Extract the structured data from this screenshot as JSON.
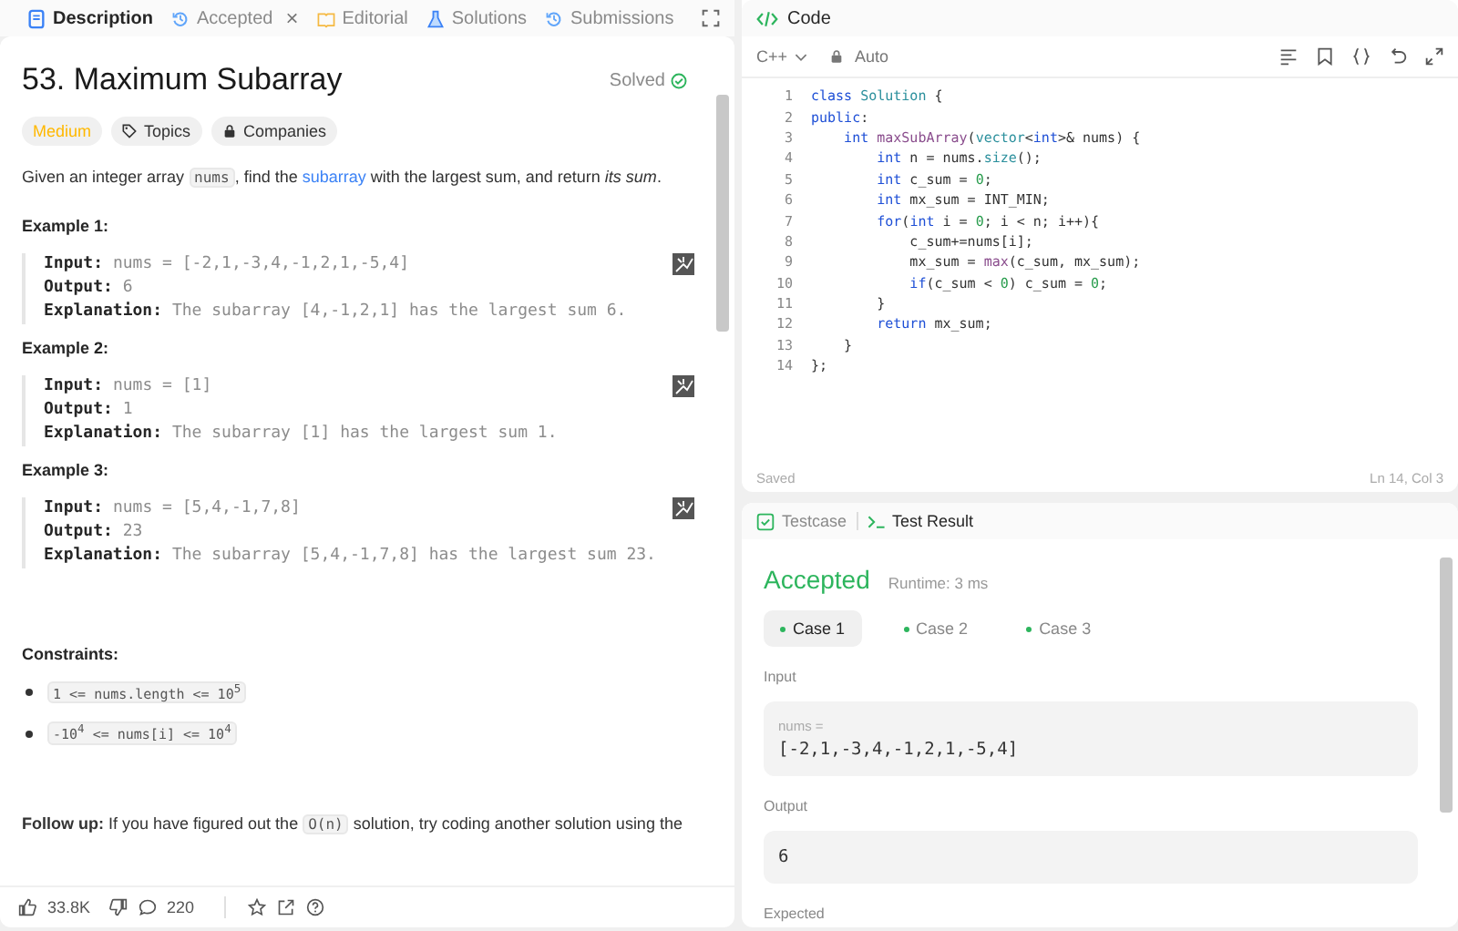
{
  "left_tabs": [
    {
      "label": "Description",
      "selected": true
    },
    {
      "label": "Accepted",
      "selected": false,
      "close": "×"
    },
    {
      "label": "Editorial",
      "selected": false
    },
    {
      "label": "Solutions",
      "selected": false
    },
    {
      "label": "Submissions",
      "selected": false
    }
  ],
  "problem": {
    "title": "53. Maximum Subarray",
    "status": "Solved",
    "difficulty": "Medium",
    "tags": [
      "Topics",
      "Companies"
    ],
    "description": [
      {
        "kind": "text",
        "t": "Given an integer array "
      },
      {
        "kind": "code",
        "t": "nums"
      },
      {
        "kind": "text",
        "t": ", find the "
      },
      {
        "kind": "link",
        "t": "subarray"
      },
      {
        "kind": "text",
        "t": " with the largest sum, and return "
      },
      {
        "kind": "italic",
        "t": "its sum"
      },
      {
        "kind": "text",
        "t": "."
      }
    ],
    "examples": [
      {
        "title": "Example 1:",
        "input_label": "Input:",
        "input": "nums = [-2,1,-3,4,-1,2,1,-5,4]",
        "output_label": "Output:",
        "output": "6",
        "explanation_label": "Explanation:",
        "explanation": "The subarray [4,-1,2,1] has the largest sum 6."
      },
      {
        "title": "Example 2:",
        "input_label": "Input:",
        "input": "nums = [1]",
        "output_label": "Output:",
        "output": "1",
        "explanation_label": "Explanation:",
        "explanation": "The subarray [1] has the largest sum 1."
      },
      {
        "title": "Example 3:",
        "input_label": "Input:",
        "input": "nums = [5,4,-1,7,8]",
        "output_label": "Output:",
        "output": "23",
        "explanation_label": "Explanation:",
        "explanation": "The subarray [5,4,-1,7,8] has the largest sum 23."
      }
    ],
    "constraints_title": "Constraints:",
    "constraints": [
      "1 <= nums.length <= 10$^{5}$",
      "-10$^{4}$ <= nums[i] <= 10$^{4}$"
    ],
    "follow_up": [
      {
        "kind": "bold",
        "t": "Follow up:"
      },
      {
        "kind": "text",
        "t": " If you have figured out the "
      },
      {
        "kind": "code",
        "t": "O(n)"
      },
      {
        "kind": "text",
        "t": " solution, try coding another solution using the"
      }
    ]
  },
  "bottom_bar": {
    "likes": "33.8K",
    "comments": "220"
  },
  "code_panel": {
    "title": "Code",
    "language": "C++",
    "mode": "Auto",
    "status": "Saved",
    "cursor": "Ln 14, Col 3",
    "lines": [
      {
        "n": "1",
        "tokens": [
          {
            "kind": "keyword",
            "t": "class"
          },
          {
            "kind": "type",
            "t": " Solution"
          },
          {
            "kind": "plain",
            "t": " {"
          }
        ]
      },
      {
        "n": "2",
        "tokens": [
          {
            "kind": "keyword",
            "t": "public"
          },
          {
            "kind": "plain",
            "t": ":"
          }
        ]
      },
      {
        "n": "3",
        "tokens": [
          {
            "kind": "keyword",
            "t": "    int"
          },
          {
            "kind": "function",
            "t": " maxSubArray"
          },
          {
            "kind": "plain",
            "t": "("
          },
          {
            "kind": "type",
            "t": "vector"
          },
          {
            "kind": "plain",
            "t": "<"
          },
          {
            "kind": "keyword",
            "t": "int"
          },
          {
            "kind": "plain",
            "t": ">& nums) {"
          }
        ]
      },
      {
        "n": "4",
        "tokens": [
          {
            "kind": "keyword",
            "t": "        int"
          },
          {
            "kind": "plain",
            "t": " n = nums."
          },
          {
            "kind": "type",
            "t": "size"
          },
          {
            "kind": "plain",
            "t": "();"
          }
        ]
      },
      {
        "n": "5",
        "tokens": [
          {
            "kind": "keyword",
            "t": "        int"
          },
          {
            "kind": "plain",
            "t": " c_sum = "
          },
          {
            "kind": "number",
            "t": "0"
          },
          {
            "kind": "plain",
            "t": ";"
          }
        ]
      },
      {
        "n": "6",
        "tokens": [
          {
            "kind": "keyword",
            "t": "        int"
          },
          {
            "kind": "plain",
            "t": " mx_sum = INT_MIN;"
          }
        ]
      },
      {
        "n": "7",
        "tokens": [
          {
            "kind": "keyword",
            "t": "        for"
          },
          {
            "kind": "plain",
            "t": "("
          },
          {
            "kind": "keyword",
            "t": "int"
          },
          {
            "kind": "plain",
            "t": " i = "
          },
          {
            "kind": "number",
            "t": "0"
          },
          {
            "kind": "plain",
            "t": "; i < n; i++){"
          }
        ]
      },
      {
        "n": "8",
        "tokens": [
          {
            "kind": "plain",
            "t": "            c_sum+=nums[i];"
          }
        ]
      },
      {
        "n": "9",
        "tokens": [
          {
            "kind": "plain",
            "t": "            mx_sum = "
          },
          {
            "kind": "function",
            "t": "max"
          },
          {
            "kind": "plain",
            "t": "(c_sum, mx_sum);"
          }
        ]
      },
      {
        "n": "10",
        "tokens": [
          {
            "kind": "keyword",
            "t": "            if"
          },
          {
            "kind": "plain",
            "t": "(c_sum < "
          },
          {
            "kind": "number",
            "t": "0"
          },
          {
            "kind": "plain",
            "t": ") c_sum = "
          },
          {
            "kind": "number",
            "t": "0"
          },
          {
            "kind": "plain",
            "t": ";"
          }
        ]
      },
      {
        "n": "11",
        "tokens": [
          {
            "kind": "plain",
            "t": "        }"
          }
        ]
      },
      {
        "n": "12",
        "tokens": [
          {
            "kind": "keyword",
            "t": "        return"
          },
          {
            "kind": "plain",
            "t": " mx_sum;"
          }
        ]
      },
      {
        "n": "13",
        "tokens": [
          {
            "kind": "plain",
            "t": "    }"
          }
        ]
      },
      {
        "n": "14",
        "tokens": [
          {
            "kind": "plain",
            "t": "};"
          }
        ]
      }
    ]
  },
  "result_panel": {
    "tabs": [
      {
        "label": "Testcase",
        "selected": false
      },
      {
        "label": "Test Result",
        "selected": true
      }
    ],
    "verdict": "Accepted",
    "runtime": "Runtime: 3 ms",
    "cases": [
      {
        "label": "Case 1",
        "selected": true
      },
      {
        "label": "Case 2",
        "selected": false
      },
      {
        "label": "Case 3",
        "selected": false
      }
    ],
    "input_label": "Input",
    "input_name": "nums =",
    "input_value": "[-2,1,-3,4,-1,2,1,-5,4]",
    "output_label": "Output",
    "output_value": "6",
    "expected_label": "Expected"
  }
}
